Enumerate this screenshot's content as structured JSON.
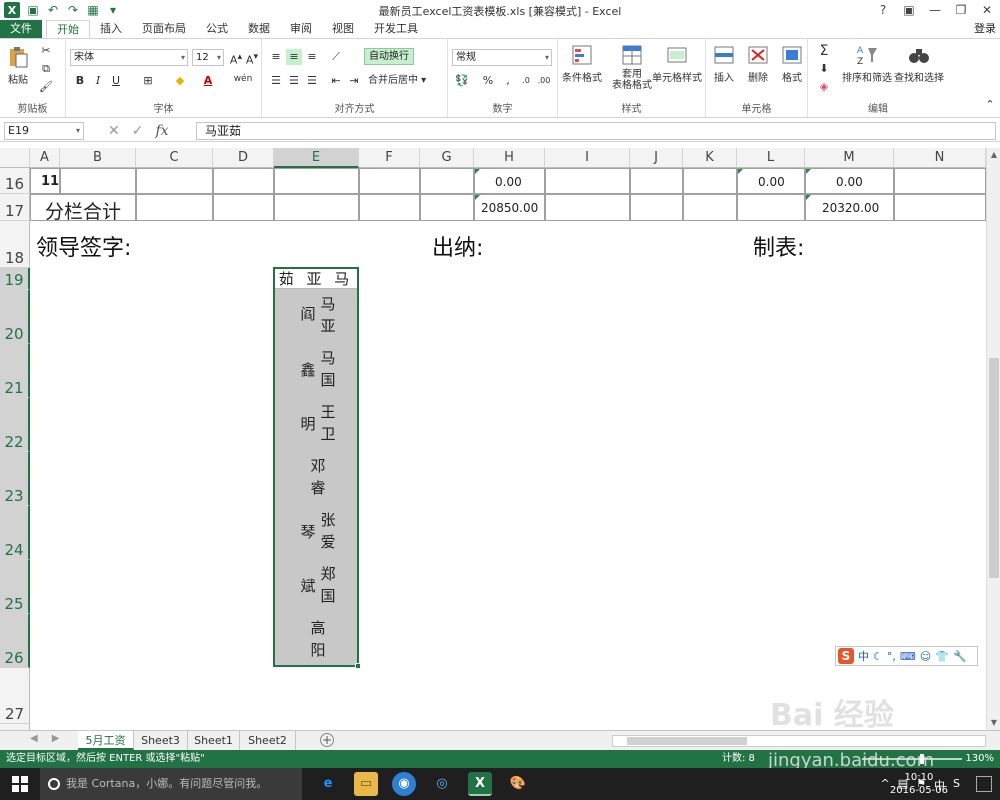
{
  "window": {
    "title": "最新员工excel工资表模板.xls  [兼容模式] - Excel",
    "controls": [
      "?",
      "▣",
      "—",
      "❐",
      "✕"
    ]
  },
  "ribbon_tabs": [
    "文件",
    "开始",
    "插入",
    "页面布局",
    "公式",
    "数据",
    "审阅",
    "视图",
    "开发工具"
  ],
  "active_tab": "开始",
  "login": "登录",
  "ribbon": {
    "clipboard": {
      "paste": "粘贴",
      "label": "剪贴板"
    },
    "font": {
      "name": "宋体",
      "size": "12",
      "bold": "B",
      "italic": "I",
      "underline": "U",
      "label": "字体",
      "font_color_label": "A",
      "wen": "wén"
    },
    "alignment": {
      "wrap": "自动换行",
      "merge": "合并后居中",
      "label": "对齐方式"
    },
    "number": {
      "format": "常规",
      "percent": "%",
      "comma": ",",
      "label": "数字"
    },
    "styles": {
      "conditional": "条件格式",
      "table_format": "套用\n表格格式",
      "cell_style": "单元格样式",
      "label": "样式"
    },
    "cells": {
      "insert": "插入",
      "delete": "删除",
      "format": "格式",
      "label": "单元格"
    },
    "editing": {
      "sort": "排序和筛选",
      "find": "查找和选择",
      "label": "编辑"
    }
  },
  "formula_bar": {
    "name_box": "E19",
    "formula": "马亚茹",
    "fx": "fx"
  },
  "columns": [
    "A",
    "B",
    "C",
    "D",
    "E",
    "F",
    "G",
    "H",
    "I",
    "J",
    "K",
    "L",
    "M",
    "N"
  ],
  "selected_column": "E",
  "rows": [
    "16",
    "17",
    "18",
    "19",
    "20",
    "21",
    "22",
    "23",
    "24",
    "25",
    "26",
    "27"
  ],
  "cells": {
    "a16": "11",
    "h16": "0.00",
    "l16": "0.00",
    "m16": "0.00",
    "a17": "分栏合计",
    "h17": "20850.00",
    "m17": "20320.00"
  },
  "signatures": {
    "leader": "领导签字:",
    "cashier": "出纳:",
    "maker": "制表:"
  },
  "selected_cell": {
    "header": "茹 亚 马",
    "columns": [
      {
        "left": "阎",
        "right": "马亚"
      },
      {
        "left": "鑫",
        "right": "马国"
      },
      {
        "left": "明",
        "right": "王卫"
      },
      {
        "left": "",
        "right": "邓睿"
      },
      {
        "left": "琴",
        "right": "张爱"
      },
      {
        "left": "斌",
        "right": "郑国"
      },
      {
        "left": "",
        "right": "高阳"
      }
    ]
  },
  "ime_bar": {
    "logo": "S",
    "mode": "中"
  },
  "sheets": [
    "5月工资",
    "Sheet3",
    "Sheet1",
    "Sheet2"
  ],
  "active_sheet": "5月工资",
  "status": {
    "message": "选定目标区域，然后按 ENTER 或选择\"粘贴\"",
    "count": "计数: 8",
    "zoom": "130%"
  },
  "taskbar": {
    "search": "我是 Cortana，小娜。有问题尽管问我。",
    "time": "10:10",
    "date": "2016-05-06",
    "ime": "中"
  },
  "watermark": {
    "logo": "Bai 经验",
    "url": "jingyan.baidu.com"
  }
}
